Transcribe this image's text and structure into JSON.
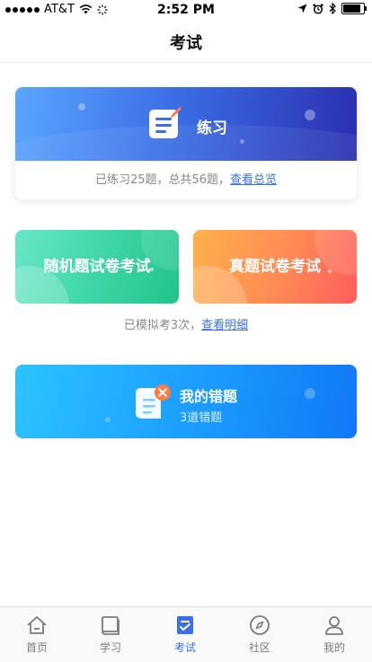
{
  "status_bar": {
    "carrier": "AT&T",
    "time": "2:52 PM"
  },
  "nav": {
    "title": "考试"
  },
  "practice": {
    "label": "练习",
    "summary": "已练习25题，总共56题，",
    "link": "查看总览"
  },
  "exams": {
    "random_label": "随机题试卷考试",
    "real_label": "真题试卷考试",
    "mock_summary": "已模拟考3次，",
    "mock_link": "查看明细"
  },
  "wrong": {
    "title": "我的错题",
    "count_text": "3道错题"
  },
  "tabs": [
    {
      "label": "首页",
      "icon": "home-icon"
    },
    {
      "label": "学习",
      "icon": "book-icon"
    },
    {
      "label": "考试",
      "icon": "exam-icon",
      "active": true
    },
    {
      "label": "社区",
      "icon": "compass-icon"
    },
    {
      "label": "我的",
      "icon": "user-icon"
    }
  ],
  "colors": {
    "accent": "#3b6fe6",
    "tab_inactive": "#7a7a7a"
  }
}
